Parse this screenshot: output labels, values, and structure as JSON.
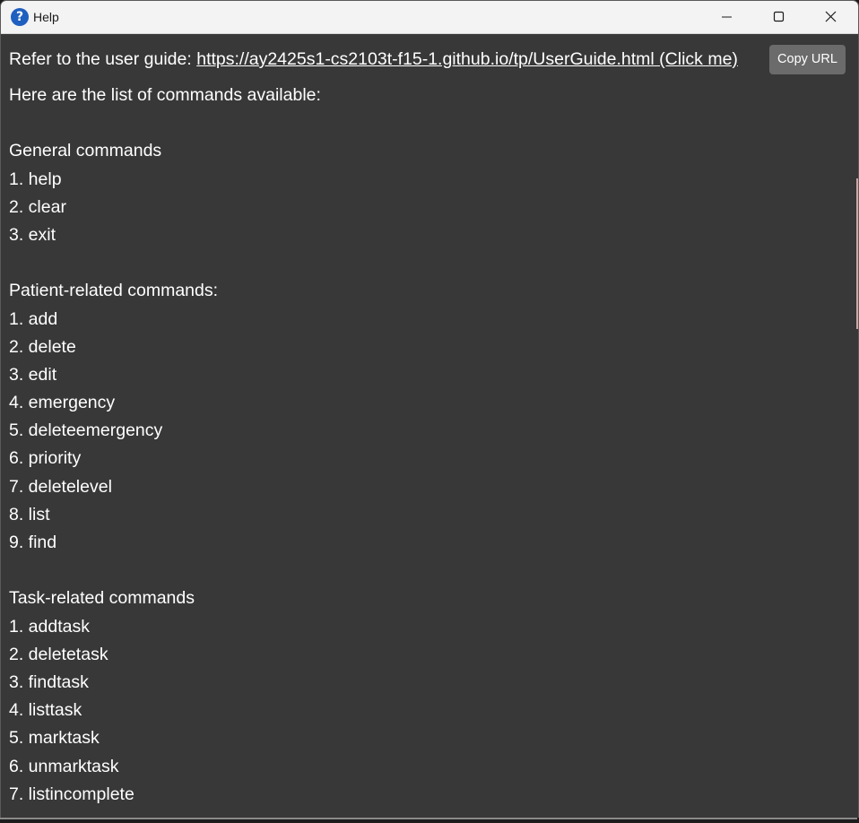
{
  "window": {
    "title": "Help",
    "app_icon_glyph": "?",
    "icon_color": "#1f5fbf",
    "controls": {
      "minimize": "minimize-icon",
      "maximize": "maximize-icon",
      "close": "close-icon"
    }
  },
  "header": {
    "prefix": "Refer to the user guide: ",
    "url_text": "https://ay2425s1-cs2103t-f15-1.github.io/tp/UserGuide.html (Click me)",
    "copy_button": "Copy URL"
  },
  "lines": [
    "Here are the list of commands available:",
    "",
    "General commands",
    "1. help",
    "2. clear",
    "3. exit",
    "",
    "Patient-related commands:",
    "1. add",
    "2. delete",
    "3. edit",
    "4. emergency",
    "5. deleteemergency",
    "6. priority",
    "7. deletelevel",
    "8. list",
    "9. find",
    "",
    "Task-related commands",
    "1. addtask",
    "2. deletetask",
    "3. findtask",
    "4. listtask",
    "5. marktask",
    "6. unmarktask",
    "7. listincomplete"
  ],
  "colors": {
    "background": "#383838",
    "text": "#ffffff",
    "button": "#6b6b6b",
    "titlebar": "#f3f3f3"
  }
}
